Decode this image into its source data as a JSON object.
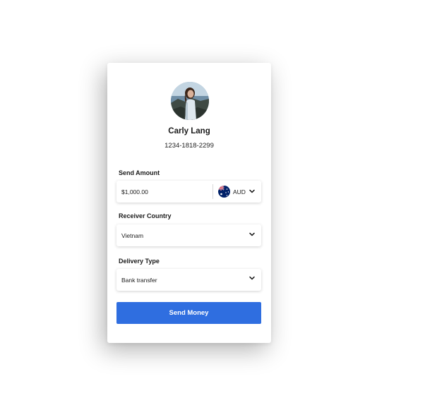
{
  "profile": {
    "name": "Carly Lang",
    "account_number": "1234-1818-2299"
  },
  "send_amount": {
    "label": "Send Amount",
    "value": "$1,000.00",
    "currency": "AUD",
    "currency_flag": "australia-flag-icon"
  },
  "receiver_country": {
    "label": "Receiver Country",
    "value": "Vietnam"
  },
  "delivery_type": {
    "label": "Delivery Type",
    "value": "Bank transfer"
  },
  "actions": {
    "send_label": "Send Money"
  },
  "colors": {
    "primary_button": "#2f6ee0",
    "card_background": "#ffffff",
    "page_background": "#ffffff"
  }
}
